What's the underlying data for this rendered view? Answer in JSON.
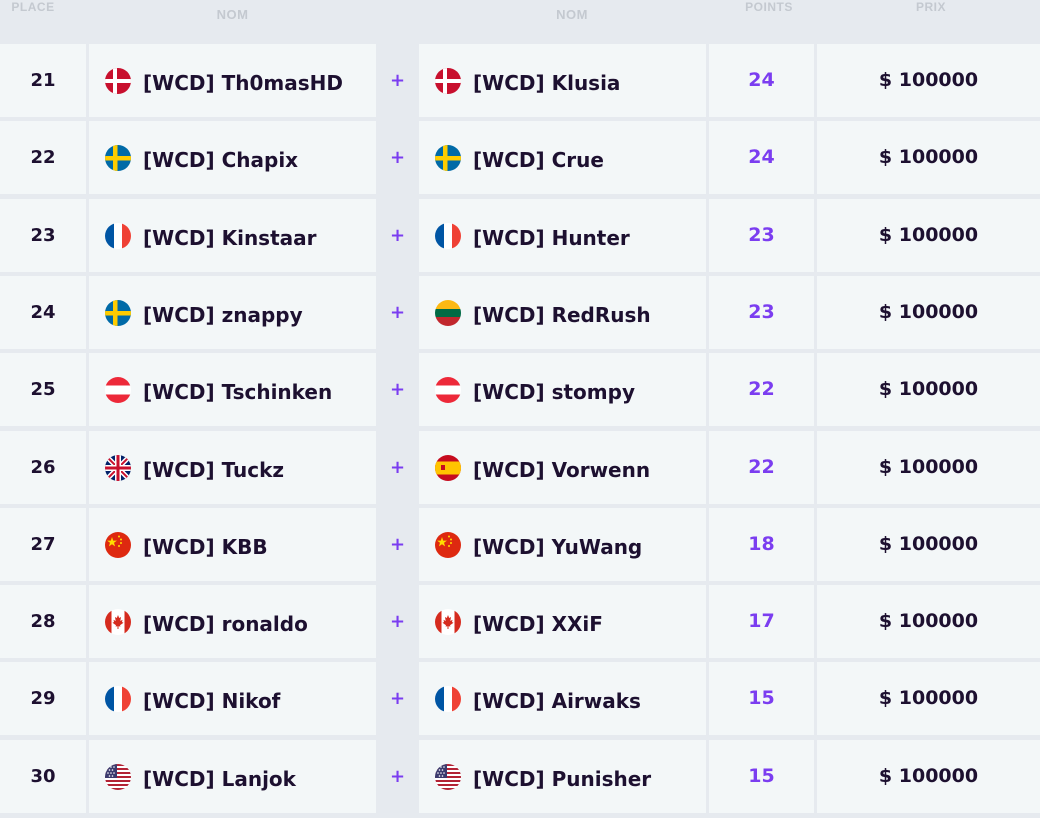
{
  "header": {
    "place": "PLACE",
    "name1": "NOM",
    "name2": "NOM",
    "points": "POINTS",
    "prize": "PRIX"
  },
  "plus_symbol": "+",
  "rows": [
    {
      "place": "21",
      "p1": {
        "name": "[WCD] Th0masHD",
        "flag": "denmark"
      },
      "p2": {
        "name": "[WCD] Klusia",
        "flag": "denmark"
      },
      "points": "24",
      "prize": "$ 100000"
    },
    {
      "place": "22",
      "p1": {
        "name": "[WCD] Chapix",
        "flag": "sweden"
      },
      "p2": {
        "name": "[WCD] Crue",
        "flag": "sweden"
      },
      "points": "24",
      "prize": "$ 100000"
    },
    {
      "place": "23",
      "p1": {
        "name": "[WCD] Kinstaar",
        "flag": "france"
      },
      "p2": {
        "name": "[WCD] Hunter",
        "flag": "france"
      },
      "points": "23",
      "prize": "$ 100000"
    },
    {
      "place": "24",
      "p1": {
        "name": "[WCD] znappy",
        "flag": "sweden"
      },
      "p2": {
        "name": "[WCD] RedRush",
        "flag": "lithuania"
      },
      "points": "23",
      "prize": "$ 100000"
    },
    {
      "place": "25",
      "p1": {
        "name": "[WCD] Tschinken",
        "flag": "austria"
      },
      "p2": {
        "name": "[WCD] stompy",
        "flag": "austria"
      },
      "points": "22",
      "prize": "$ 100000"
    },
    {
      "place": "26",
      "p1": {
        "name": "[WCD] Tuckz",
        "flag": "uk"
      },
      "p2": {
        "name": "[WCD] Vorwenn",
        "flag": "spain"
      },
      "points": "22",
      "prize": "$ 100000"
    },
    {
      "place": "27",
      "p1": {
        "name": "[WCD] KBB",
        "flag": "china"
      },
      "p2": {
        "name": "[WCD] YuWang",
        "flag": "china"
      },
      "points": "18",
      "prize": "$ 100000"
    },
    {
      "place": "28",
      "p1": {
        "name": "[WCD] ronaldo",
        "flag": "canada"
      },
      "p2": {
        "name": "[WCD] XXiF",
        "flag": "canada"
      },
      "points": "17",
      "prize": "$ 100000"
    },
    {
      "place": "29",
      "p1": {
        "name": "[WCD] Nikof",
        "flag": "france"
      },
      "p2": {
        "name": "[WCD] Airwaks",
        "flag": "france"
      },
      "points": "15",
      "prize": "$ 100000"
    },
    {
      "place": "30",
      "p1": {
        "name": "[WCD] Lanjok",
        "flag": "usa"
      },
      "p2": {
        "name": "[WCD] Punisher",
        "flag": "usa"
      },
      "points": "15",
      "prize": "$ 100000"
    }
  ],
  "colors": {
    "accent": "#7b3df0",
    "text": "#1d1030",
    "cell_bg": "#f3f7f8",
    "page_bg": "#e6eaef",
    "header_text": "#c4c9d0"
  }
}
